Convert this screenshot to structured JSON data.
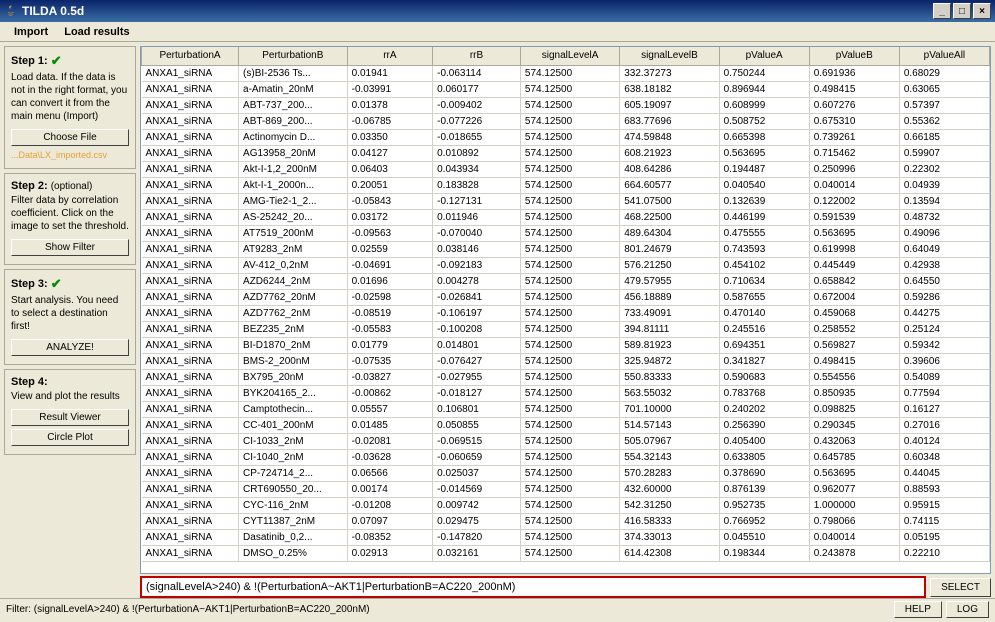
{
  "window": {
    "title": "TILDA 0.5d"
  },
  "menu": {
    "import": "Import",
    "load": "Load results"
  },
  "sidebar": {
    "step1": {
      "title": "Step 1:",
      "desc": "Load data. If the data is not in the right format, you can convert it from the main menu (Import)",
      "btn": "Choose File",
      "path": "...Data\\LX_imported.csv"
    },
    "step2": {
      "title": "Step 2:",
      "opt": "(optional)",
      "desc": "Filter data by correlation coefficient. Click on the image to set the threshold.",
      "btn": "Show Filter"
    },
    "step3": {
      "title": "Step 3:",
      "desc": "Start analysis. You need to select a destination first!",
      "btn": "ANALYZE!"
    },
    "step4": {
      "title": "Step 4:",
      "desc": "View and plot the results",
      "btn1": "Result Viewer",
      "btn2": "Circle Plot"
    }
  },
  "table": {
    "headers": [
      "PerturbationA",
      "PerturbationB",
      "rrA",
      "rrB",
      "signalLevelA",
      "signalLevelB",
      "pValueA",
      "pValueB",
      "pValueAll"
    ],
    "rows": [
      [
        "ANXA1_siRNA",
        "(s)BI-2536 Ts...",
        "0.01941",
        "-0.063114",
        "574.12500",
        "332.37273",
        "0.750244",
        "0.691936",
        "0.68029"
      ],
      [
        "ANXA1_siRNA",
        "a-Amatin_20nM",
        "-0.03991",
        "0.060177",
        "574.12500",
        "638.18182",
        "0.896944",
        "0.498415",
        "0.63065"
      ],
      [
        "ANXA1_siRNA",
        "ABT-737_200...",
        "0.01378",
        "-0.009402",
        "574.12500",
        "605.19097",
        "0.608999",
        "0.607276",
        "0.57397"
      ],
      [
        "ANXA1_siRNA",
        "ABT-869_200...",
        "-0.06785",
        "-0.077226",
        "574.12500",
        "683.77696",
        "0.508752",
        "0.675310",
        "0.55362"
      ],
      [
        "ANXA1_siRNA",
        "Actinomycin D...",
        "0.03350",
        "-0.018655",
        "574.12500",
        "474.59848",
        "0.665398",
        "0.739261",
        "0.66185"
      ],
      [
        "ANXA1_siRNA",
        "AG13958_20nM",
        "0.04127",
        "0.010892",
        "574.12500",
        "608.21923",
        "0.563695",
        "0.715462",
        "0.59907"
      ],
      [
        "ANXA1_siRNA",
        "Akt-I-1,2_200nM",
        "0.06403",
        "0.043934",
        "574.12500",
        "408.64286",
        "0.194487",
        "0.250996",
        "0.22302"
      ],
      [
        "ANXA1_siRNA",
        "Akt-I-1_2000n...",
        "0.20051",
        "0.183828",
        "574.12500",
        "664.60577",
        "0.040540",
        "0.040014",
        "0.04939"
      ],
      [
        "ANXA1_siRNA",
        "AMG-Tie2-1_2...",
        "-0.05843",
        "-0.127131",
        "574.12500",
        "541.07500",
        "0.132639",
        "0.122002",
        "0.13594"
      ],
      [
        "ANXA1_siRNA",
        "AS-25242_20...",
        "0.03172",
        "0.011946",
        "574.12500",
        "468.22500",
        "0.446199",
        "0.591539",
        "0.48732"
      ],
      [
        "ANXA1_siRNA",
        "AT7519_200nM",
        "-0.09563",
        "-0.070040",
        "574.12500",
        "489.64304",
        "0.475555",
        "0.563695",
        "0.49096"
      ],
      [
        "ANXA1_siRNA",
        "AT9283_2nM",
        "0.02559",
        "0.038146",
        "574.12500",
        "801.24679",
        "0.743593",
        "0.619998",
        "0.64049"
      ],
      [
        "ANXA1_siRNA",
        "AV-412_0,2nM",
        "-0.04691",
        "-0.092183",
        "574.12500",
        "576.21250",
        "0.454102",
        "0.445449",
        "0.42938"
      ],
      [
        "ANXA1_siRNA",
        "AZD6244_2nM",
        "0.01696",
        "0.004278",
        "574.12500",
        "479.57955",
        "0.710634",
        "0.658842",
        "0.64550"
      ],
      [
        "ANXA1_siRNA",
        "AZD7762_20nM",
        "-0.02598",
        "-0.026841",
        "574.12500",
        "456.18889",
        "0.587655",
        "0.672004",
        "0.59286"
      ],
      [
        "ANXA1_siRNA",
        "AZD7762_2nM",
        "-0.08519",
        "-0.106197",
        "574.12500",
        "733.49091",
        "0.470140",
        "0.459068",
        "0.44275"
      ],
      [
        "ANXA1_siRNA",
        "BEZ235_2nM",
        "-0.05583",
        "-0.100208",
        "574.12500",
        "394.81111",
        "0.245516",
        "0.258552",
        "0.25124"
      ],
      [
        "ANXA1_siRNA",
        "BI-D1870_2nM",
        "0.01779",
        "0.014801",
        "574.12500",
        "589.81923",
        "0.694351",
        "0.569827",
        "0.59342"
      ],
      [
        "ANXA1_siRNA",
        "BMS-2_200nM",
        "-0.07535",
        "-0.076427",
        "574.12500",
        "325.94872",
        "0.341827",
        "0.498415",
        "0.39606"
      ],
      [
        "ANXA1_siRNA",
        "BX795_20nM",
        "-0.03827",
        "-0.027955",
        "574.12500",
        "550.83333",
        "0.590683",
        "0.554556",
        "0.54089"
      ],
      [
        "ANXA1_siRNA",
        "BYK204165_2...",
        "-0.00862",
        "-0.018127",
        "574.12500",
        "563.55032",
        "0.783768",
        "0.850935",
        "0.77594"
      ],
      [
        "ANXA1_siRNA",
        "Camptothecin...",
        "0.05557",
        "0.106801",
        "574.12500",
        "701.10000",
        "0.240202",
        "0.098825",
        "0.16127"
      ],
      [
        "ANXA1_siRNA",
        "CC-401_200nM",
        "0.01485",
        "0.050855",
        "574.12500",
        "514.57143",
        "0.256390",
        "0.290345",
        "0.27016"
      ],
      [
        "ANXA1_siRNA",
        "CI-1033_2nM",
        "-0.02081",
        "-0.069515",
        "574.12500",
        "505.07967",
        "0.405400",
        "0.432063",
        "0.40124"
      ],
      [
        "ANXA1_siRNA",
        "CI-1040_2nM",
        "-0.03628",
        "-0.060659",
        "574.12500",
        "554.32143",
        "0.633805",
        "0.645785",
        "0.60348"
      ],
      [
        "ANXA1_siRNA",
        "CP-724714_2...",
        "0.06566",
        "0.025037",
        "574.12500",
        "570.28283",
        "0.378690",
        "0.563695",
        "0.44045"
      ],
      [
        "ANXA1_siRNA",
        "CRT690550_20...",
        "0.00174",
        "-0.014569",
        "574.12500",
        "432.60000",
        "0.876139",
        "0.962077",
        "0.88593"
      ],
      [
        "ANXA1_siRNA",
        "CYC-116_2nM",
        "-0.01208",
        "0.009742",
        "574.12500",
        "542.31250",
        "0.952735",
        "1.000000",
        "0.95915"
      ],
      [
        "ANXA1_siRNA",
        "CYT11387_2nM",
        "0.07097",
        "0.029475",
        "574.12500",
        "416.58333",
        "0.766952",
        "0.798066",
        "0.74115"
      ],
      [
        "ANXA1_siRNA",
        "Dasatinib_0,2...",
        "-0.08352",
        "-0.147820",
        "574.12500",
        "374.33013",
        "0.045510",
        "0.040014",
        "0.05195"
      ],
      [
        "ANXA1_siRNA",
        "DMSO_0.25%",
        "0.02913",
        "0.032161",
        "574.12500",
        "614.42308",
        "0.198344",
        "0.243878",
        "0.22210"
      ]
    ]
  },
  "filter": {
    "value": "(signalLevelA>240) & !(PerturbationA~AKT1|PerturbationB=AC220_200nM)",
    "select": "SELECT"
  },
  "status": {
    "label": "Filter: (signalLevelA>240) & !(PerturbationA~AKT1|PerturbationB=AC220_200nM)",
    "help": "HELP",
    "log": "LOG"
  }
}
